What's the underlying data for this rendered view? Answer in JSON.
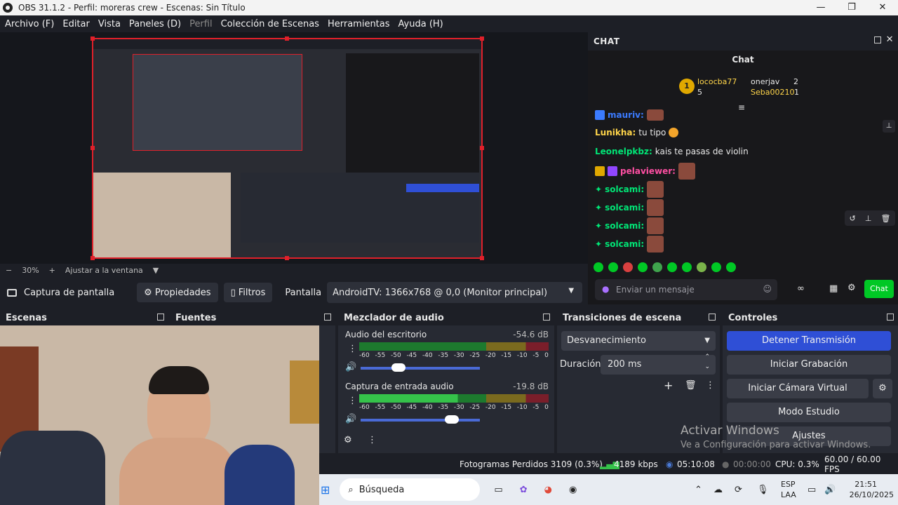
{
  "window": {
    "title": "OBS 31.1.2 - Perfil: moreras crew - Escenas: Sin Título"
  },
  "menu": [
    "Archivo (F)",
    "Editar",
    "Vista",
    "Paneles (D)",
    "Perfil",
    "Colección de Escenas",
    "Herramientas",
    "Ayuda (H)"
  ],
  "zoom": {
    "minus": "−",
    "value": "30%",
    "plus": "+",
    "fit": "Ajustar a la ventana"
  },
  "source_bar": {
    "source_name": "Captura de pantalla",
    "properties": "Propiedades",
    "filters": "Filtros",
    "display_label": "Pantalla",
    "display_value": "AndroidTV: 1366x768 @ 0,0 (Monitor principal)"
  },
  "chat": {
    "dock_title": "CHAT",
    "title": "Chat",
    "leaderboard": [
      {
        "rank": "1",
        "name": "lococba77",
        "count": "5"
      },
      {
        "name": "onerjav",
        "count": "2"
      },
      {
        "name": "Seba00210",
        "count": "1"
      }
    ],
    "messages": [
      {
        "user": "mauriv:",
        "text": "",
        "color": "#3b7bff"
      },
      {
        "user": "Lunikha:",
        "text": "tu tipo",
        "color": "#ffd54a"
      },
      {
        "user": "Leonelpkbz:",
        "text": "kais te pasas de violin",
        "color": "#00e676"
      },
      {
        "user": "pelaviewer:",
        "text": "",
        "color": "#ff4fa3"
      },
      {
        "user": "solcami:",
        "text": "",
        "color": "#00e676"
      },
      {
        "user": "solcami:",
        "text": "",
        "color": "#00e676"
      },
      {
        "user": "solcami:",
        "text": "",
        "color": "#00e676"
      },
      {
        "user": "solcami:",
        "text": "",
        "color": "#00e676"
      }
    ],
    "input_placeholder": "Enviar un mensaje",
    "send_button": "Chat"
  },
  "docks": {
    "scenes": "Escenas",
    "sources": "Fuentes",
    "mixer": "Mezclador de audio",
    "transitions": "Transiciones de escena",
    "controls": "Controles"
  },
  "mixer": {
    "channels": [
      {
        "name": "Audio del escritorio",
        "level": "-54.6 dB"
      },
      {
        "name": "Captura de entrada audio",
        "level": "-19.8 dB"
      }
    ],
    "scale": [
      "-60",
      "-55",
      "-50",
      "-45",
      "-40",
      "-35",
      "-30",
      "-25",
      "-20",
      "-15",
      "-10",
      "-5",
      "0"
    ]
  },
  "transitions": {
    "type": "Desvanecimiento",
    "duration_label": "Duración",
    "duration": "200 ms"
  },
  "controls": {
    "stop_stream": "Detener Transmisión",
    "start_recording": "Iniciar Grabación",
    "start_virtual_cam": "Iniciar Cámara Virtual",
    "studio_mode": "Modo Estudio",
    "settings": "Ajustes"
  },
  "watermark": {
    "line1": "Activar Windows",
    "line2": "Ve a Configuración para activar Windows."
  },
  "status": {
    "dropped": "Fotogramas Perdidos 3109 (0.3%)",
    "bitrate": "4189 kbps",
    "live_time": "05:10:08",
    "rec_time": "00:00:00",
    "cpu": "CPU: 0.3%",
    "fps": "60.00 / 60.00 FPS"
  },
  "taskbar": {
    "search": "Búsqueda",
    "lang1": "ESP",
    "lang2": "LAA",
    "time": "21:51",
    "date": "26/10/2025"
  },
  "colors": {
    "accent": "#2f4fd6",
    "chat_green": "#00c825",
    "red_border": "#e0202a"
  }
}
